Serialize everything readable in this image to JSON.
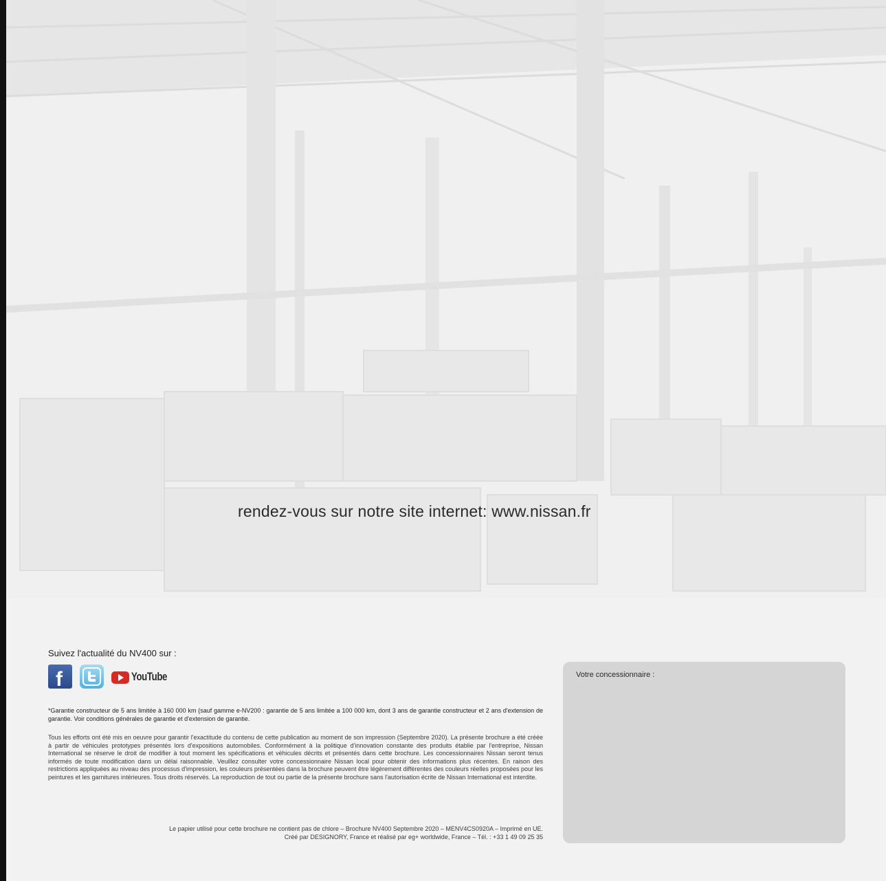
{
  "website_text": "rendez-vous sur notre site internet: www.nissan.fr",
  "social": {
    "heading": "Suivez l'actualité du NV400 sur :",
    "networks": [
      {
        "icon": "facebook-icon",
        "glyph": "f"
      },
      {
        "icon": "twitter-icon"
      },
      {
        "icon": "youtube-icon",
        "label": "YouTube"
      }
    ]
  },
  "warranty_note": "*Garantie constructeur de 5 ans limitée à 160 000 km (sauf gamme e-NV200 : garantie de 5 ans limitée a 100 000 km, dont 3 ans de garantie constructeur et 2 ans d'extension de garantie. Voir conditions générales de garantie et d'extension de garantie.",
  "disclaimer": "Tous les efforts ont été mis en oeuvre pour garantir l'exactitude du contenu de cette publication au moment de son impression (Septembre 2020). La présente brochure a été créée à partir de véhicules prototypes présentés lors d'expositions automobiles. Conformément à la politique d'innovation constante des produits établie par l'entreprise, Nissan International se réserve le droit de modifier à tout moment les spécifications et véhicules décrits et présentés dans cette brochure. Les concessionnaires Nissan seront tenus informés de toute modification dans un délai raisonnable. Veuillez consulter votre concessionnaire Nissan local pour obtenir des informations plus récentes. En raison des restrictions appliquées au niveau des processus d'impression, les couleurs présentées dans la brochure peuvent être légèrement différentes des couleurs réelles proposées pour les peintures et les garnitures intérieures. Tous droits réservés. La reproduction de tout ou partie de la présente brochure sans l'autorisation écrite de Nissan International est interdite.",
  "footer": {
    "line1": "Le papier utilisé pour cette brochure ne contient pas de chlore – Brochure NV400 Septembre 2020 – MENV4CS0920A – Imprimé en UE.",
    "line2": "Créé par DESIGNORY, France et réalisé par eg+ worldwide, France – Tél. : +33 1 49 09 25 35"
  },
  "dealer_box": {
    "label": "Votre concessionnaire :"
  },
  "colors": {
    "background": "#efefef",
    "facebook": "#3b5998",
    "twitter": "#55acee",
    "youtube": "#d62b24",
    "dealer_box": "#cdcdcd"
  }
}
